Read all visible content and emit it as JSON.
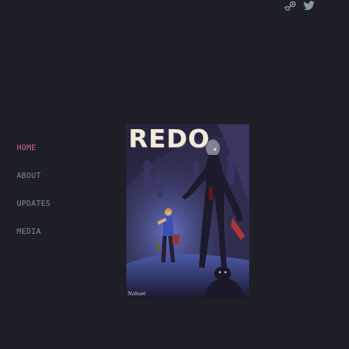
{
  "social": [
    {
      "name": "Steam",
      "icon": "steam-icon"
    },
    {
      "name": "Twitter",
      "icon": "twitter-icon"
    }
  ],
  "nav": {
    "items": [
      {
        "label": "HOME",
        "active": true
      },
      {
        "label": "ABOUT",
        "active": false
      },
      {
        "label": "UPDATES",
        "active": false
      },
      {
        "label": "MEDIA",
        "active": false
      }
    ]
  },
  "cover": {
    "title": "REDO",
    "signature": "Nahuel"
  },
  "colors": {
    "background": "#1e1e26",
    "nav_text": "#7e8c8f",
    "nav_active": "#c66a8a",
    "icon": "#8a9aa2"
  }
}
